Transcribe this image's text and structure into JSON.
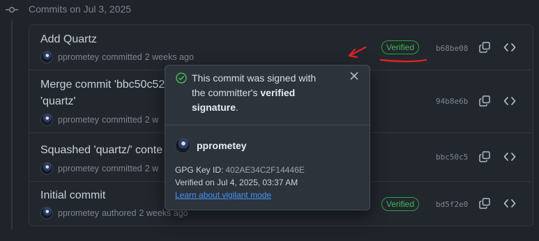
{
  "section": {
    "title": "Commits on Jul 3, 2025"
  },
  "commits": [
    {
      "message": "Add Quartz",
      "author": "pprometey",
      "verb": "committed",
      "when": "2 weeks ago",
      "badge": "Verified",
      "sha": "b68be08"
    },
    {
      "message": "Merge commit 'bbc50c52",
      "message2": "'quartz'",
      "author": "pprometey",
      "verb": "committed",
      "when": "2 w",
      "sha": "94b8e6b"
    },
    {
      "message": "Squashed 'quartz/' conte",
      "author": "pprometey",
      "verb": "committed",
      "when": "2 w",
      "sha": "bbc50c5"
    },
    {
      "message": "Initial commit",
      "author": "pprometey",
      "verb": "authored",
      "when": "2 weeks ago",
      "badge": "Verified",
      "sha": "bd5f2e0"
    }
  ],
  "popover": {
    "line1": "This commit was signed with",
    "line2_pre": "the committer's ",
    "line2_bold": "verified",
    "line3_bold": "signature",
    "line3_post": ".",
    "user": "pprometey",
    "gpg_label": "GPG Key ID:",
    "gpg_value": "402AE34C2F14446E",
    "verified_on": "Verified on Jul 4, 2025, 03:37 AM",
    "learn_link": "Learn about vigilant mode"
  },
  "colors": {
    "background": "#1f232a",
    "verified_green": "#3fb950",
    "link_blue": "#4493f8",
    "annotation_red": "#e5201f"
  },
  "icons": [
    "git-commit-icon",
    "copy-icon",
    "code-icon",
    "check-circle-icon",
    "close-icon",
    "avatar"
  ]
}
